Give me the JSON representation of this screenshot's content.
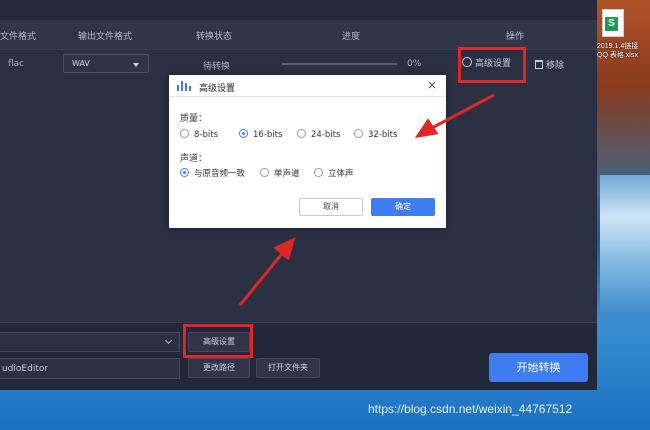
{
  "desktop": {
    "icon_caption": "2019.1.4链接 QQ 表格.xlsx",
    "icon_letter": "S"
  },
  "table": {
    "headers": [
      "文件格式",
      "输出文件格式",
      "转换状态",
      "进度",
      "操作"
    ],
    "row": {
      "source_format": "flac",
      "output_format": "WAV",
      "status": "待转换",
      "progress": "0%",
      "progress_value": 0
    },
    "actions": {
      "advanced": "高级设置",
      "remove": "移除"
    }
  },
  "bottom": {
    "path": "udioEditor",
    "advanced_button": "高级设置",
    "change_path_button": "更改路径",
    "open_folder_button": "打开文件夹",
    "start_button": "开始转换"
  },
  "dialog": {
    "title": "高级设置",
    "quality_label": "质量：",
    "quality_options": [
      "8-bits",
      "16-bits",
      "24-bits",
      "32-bits"
    ],
    "quality_selected": "16-bits",
    "channel_label": "声道：",
    "channel_options": [
      "与原音频一致",
      "单声道",
      "立体声"
    ],
    "channel_selected": "与原音频一致",
    "cancel_button": "取消",
    "ok_button": "确定"
  },
  "watermark": "https://blog.csdn.net/weixin_44767512",
  "colors": {
    "accent": "#3e7cf0",
    "highlight": "#e02626",
    "app_bg": "#2b3042"
  }
}
